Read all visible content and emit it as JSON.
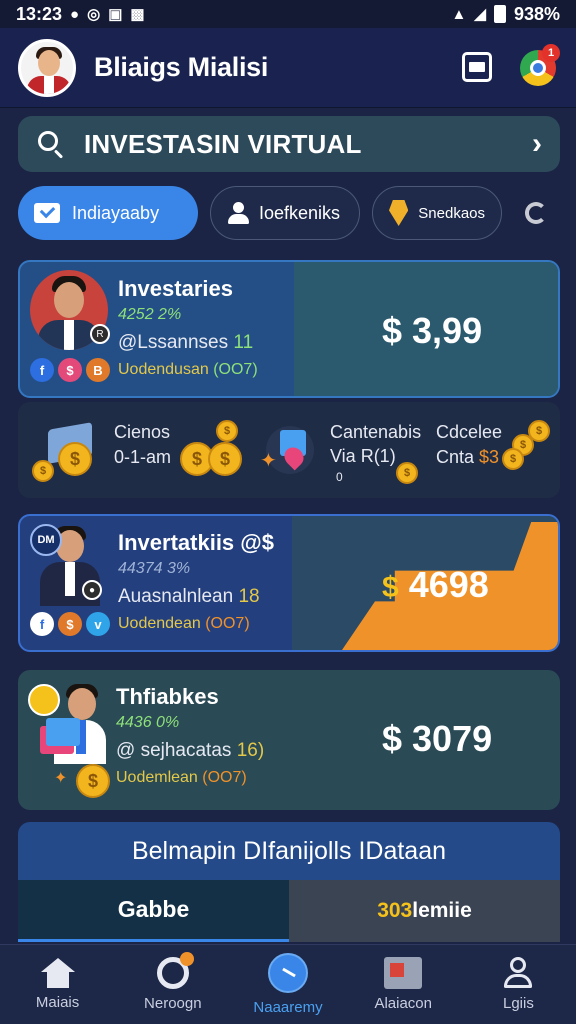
{
  "status_bar": {
    "time": "13:23",
    "battery": "938%"
  },
  "header": {
    "app_title": "Bliaigs Mialisi",
    "notification_count": "1"
  },
  "search": {
    "label": "INVESTASIN VIRTUAL"
  },
  "filters": [
    {
      "label": "Indiayaaby"
    },
    {
      "label": "Ioefkeniks"
    },
    {
      "label": "Snedkaos"
    }
  ],
  "cards": [
    {
      "title": "Investaries",
      "pct": "4252 2%",
      "sub_prefix": "@Lssannses",
      "sub_value": "11",
      "social": [
        "f",
        "$",
        "B"
      ],
      "foot_text": "Uodendusan",
      "foot_ring": "(OO7)",
      "amount": "$ 3,99"
    },
    {
      "title": "Invertatkiis @$",
      "pct": "44374 3%",
      "sub_prefix": "Auasnalnlean",
      "sub_value": "18",
      "social": [
        "f",
        "$",
        "v"
      ],
      "foot_text": "Uodendean",
      "foot_ring": "(OO7)",
      "amount_symbol": "$",
      "amount": "4698"
    },
    {
      "title": "Thfiabkes",
      "pct": "4436 0%",
      "sub_prefix": "@ sejhacatas",
      "sub_value": "16)",
      "foot_text": "Uodemlean",
      "foot_ring": "(OO7)",
      "amount": "$ 3079"
    }
  ],
  "coin_strip": {
    "item1_line1": "Cienos",
    "item1_line2": "0-1-am",
    "item2_line1": "Cantenabis",
    "item2_line2": "Via R(1)",
    "item2_line3": "0",
    "item3_line1": "Cdcelee",
    "item3_line2": "Cnta",
    "item3_value": "$3"
  },
  "bottom": {
    "title": "Belmapin DIfanijolls IDataan",
    "tab_left": "Gabbe",
    "tab_right_accent": "303",
    "tab_right_rest": " lemiie"
  },
  "nav": [
    {
      "label": "Maiais"
    },
    {
      "label": "Neroogn"
    },
    {
      "label": "Naaaremy"
    },
    {
      "label": "Alaiacon"
    },
    {
      "label": "Lgiis"
    }
  ],
  "colors": {
    "background": "#1b2444",
    "accent_blue": "#3a86e8",
    "accent_orange": "#f0922a",
    "positive_green": "#8ee07a"
  }
}
